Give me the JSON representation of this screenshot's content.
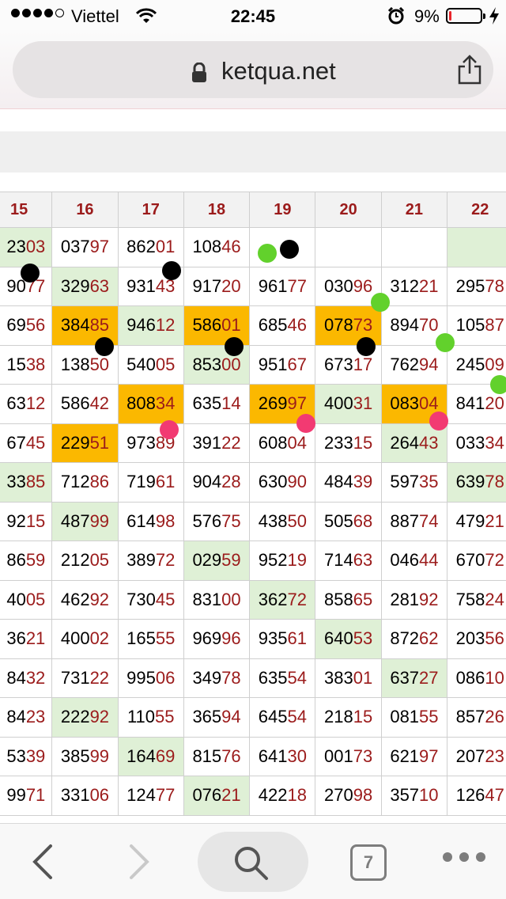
{
  "status_bar": {
    "carrier": "Viettel",
    "time": "22:45",
    "battery_percent": "9%",
    "battery_level": 0.09,
    "icons": [
      "signal-dots",
      "wifi-icon",
      "alarm-icon",
      "battery-icon",
      "charge-icon"
    ]
  },
  "browser": {
    "url": "ketqua.net",
    "icons": [
      "lock-icon",
      "share-icon"
    ]
  },
  "table": {
    "headers": [
      "",
      "15",
      "16",
      "17",
      "18",
      "19",
      "20",
      "21",
      "22"
    ],
    "rows": [
      [
        [
          "",
          "",
          ""
        ],
        [
          "2303",
          "g"
        ],
        [
          "03797",
          ""
        ],
        [
          "86201",
          ""
        ],
        [
          "10846",
          ""
        ],
        [
          "",
          ""
        ],
        [
          "",
          ""
        ],
        [
          "",
          ""
        ],
        [
          "",
          "g"
        ]
      ],
      [
        [
          "",
          "",
          ""
        ],
        [
          "9077",
          ""
        ],
        [
          "32963",
          "g"
        ],
        [
          "93143",
          ""
        ],
        [
          "91720",
          ""
        ],
        [
          "96177",
          ""
        ],
        [
          "03096",
          ""
        ],
        [
          "31221",
          ""
        ],
        [
          "29578",
          ""
        ]
      ],
      [
        [
          "",
          "",
          ""
        ],
        [
          "6956",
          ""
        ],
        [
          "38485",
          "o"
        ],
        [
          "94612",
          "g"
        ],
        [
          "58601",
          "o"
        ],
        [
          "68546",
          ""
        ],
        [
          "07873",
          "o"
        ],
        [
          "89470",
          ""
        ],
        [
          "10587",
          ""
        ]
      ],
      [
        [
          "",
          "",
          ""
        ],
        [
          "1538",
          ""
        ],
        [
          "13850",
          ""
        ],
        [
          "54005",
          ""
        ],
        [
          "85300",
          "g"
        ],
        [
          "95167",
          ""
        ],
        [
          "67317",
          ""
        ],
        [
          "76294",
          ""
        ],
        [
          "24509",
          ""
        ]
      ],
      [
        [
          "",
          "",
          ""
        ],
        [
          "6312",
          ""
        ],
        [
          "58642",
          ""
        ],
        [
          "80834",
          "o"
        ],
        [
          "63514",
          ""
        ],
        [
          "26997",
          "o"
        ],
        [
          "40031",
          "g"
        ],
        [
          "08304",
          "o"
        ],
        [
          "84120",
          ""
        ]
      ],
      [
        [
          "",
          "",
          ""
        ],
        [
          "6745",
          ""
        ],
        [
          "22951",
          "o"
        ],
        [
          "97389",
          ""
        ],
        [
          "39122",
          ""
        ],
        [
          "60804",
          ""
        ],
        [
          "23315",
          ""
        ],
        [
          "26443",
          "g"
        ],
        [
          "03334",
          ""
        ]
      ],
      [
        [
          "",
          "",
          ""
        ],
        [
          "3385",
          "g"
        ],
        [
          "71286",
          ""
        ],
        [
          "71961",
          ""
        ],
        [
          "90428",
          ""
        ],
        [
          "63090",
          ""
        ],
        [
          "48439",
          ""
        ],
        [
          "59735",
          ""
        ],
        [
          "63978",
          "g"
        ]
      ],
      [
        [
          "",
          "",
          ""
        ],
        [
          "9215",
          ""
        ],
        [
          "48799",
          "g"
        ],
        [
          "61498",
          ""
        ],
        [
          "57675",
          ""
        ],
        [
          "43850",
          ""
        ],
        [
          "50568",
          ""
        ],
        [
          "88774",
          ""
        ],
        [
          "47921",
          ""
        ]
      ],
      [
        [
          "",
          "",
          ""
        ],
        [
          "8659",
          ""
        ],
        [
          "21205",
          ""
        ],
        [
          "38972",
          ""
        ],
        [
          "02959",
          "g"
        ],
        [
          "95219",
          ""
        ],
        [
          "71463",
          ""
        ],
        [
          "04644",
          ""
        ],
        [
          "67072",
          ""
        ]
      ],
      [
        [
          "",
          "",
          ""
        ],
        [
          "4005",
          ""
        ],
        [
          "46292",
          ""
        ],
        [
          "73045",
          ""
        ],
        [
          "83100",
          ""
        ],
        [
          "36272",
          "g"
        ],
        [
          "85865",
          ""
        ],
        [
          "28192",
          ""
        ],
        [
          "75824",
          ""
        ]
      ],
      [
        [
          "",
          "",
          ""
        ],
        [
          "3621",
          ""
        ],
        [
          "40002",
          ""
        ],
        [
          "16555",
          ""
        ],
        [
          "96996",
          ""
        ],
        [
          "93561",
          ""
        ],
        [
          "64053",
          "g"
        ],
        [
          "87262",
          ""
        ],
        [
          "20356",
          ""
        ]
      ],
      [
        [
          "",
          "",
          ""
        ],
        [
          "8432",
          ""
        ],
        [
          "73122",
          ""
        ],
        [
          "99506",
          ""
        ],
        [
          "34978",
          ""
        ],
        [
          "63554",
          ""
        ],
        [
          "38301",
          ""
        ],
        [
          "63727",
          "g"
        ],
        [
          "08610",
          ""
        ]
      ],
      [
        [
          "",
          "",
          ""
        ],
        [
          "8423",
          ""
        ],
        [
          "22292",
          "g"
        ],
        [
          "11055",
          ""
        ],
        [
          "36594",
          ""
        ],
        [
          "64554",
          ""
        ],
        [
          "21815",
          ""
        ],
        [
          "08155",
          ""
        ],
        [
          "85726",
          ""
        ]
      ],
      [
        [
          "",
          "",
          ""
        ],
        [
          "5339",
          ""
        ],
        [
          "38599",
          ""
        ],
        [
          "16469",
          "g"
        ],
        [
          "81576",
          ""
        ],
        [
          "64130",
          ""
        ],
        [
          "00173",
          ""
        ],
        [
          "62197",
          ""
        ],
        [
          "20723",
          ""
        ]
      ],
      [
        [
          "",
          "",
          ""
        ],
        [
          "9971",
          ""
        ],
        [
          "33106",
          ""
        ],
        [
          "12477",
          ""
        ],
        [
          "07621",
          "g"
        ],
        [
          "42218",
          ""
        ],
        [
          "27098",
          ""
        ],
        [
          "35710",
          ""
        ],
        [
          "12647",
          ""
        ]
      ]
    ]
  },
  "marker_colors": {
    "black": "#000000",
    "green": "#62d12c",
    "pink": "#f23a72"
  },
  "toolbar": {
    "tab_count": "7",
    "icons": [
      "back-icon",
      "forward-icon",
      "search-icon",
      "tabs-icon",
      "more-icon"
    ]
  }
}
